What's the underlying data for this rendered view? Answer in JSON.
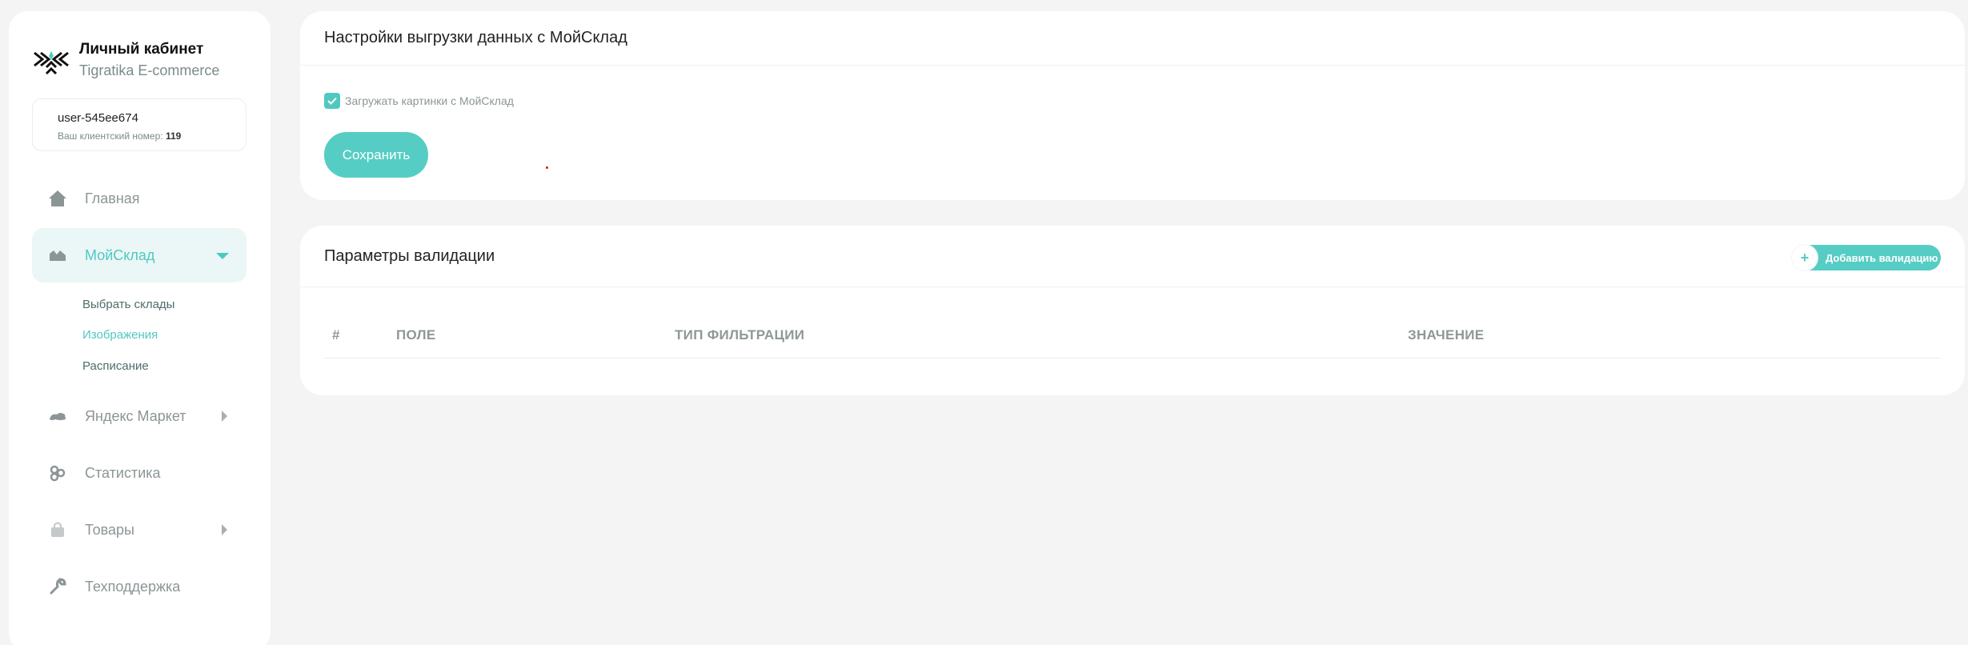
{
  "brand": {
    "title": "Личный кабинет",
    "subtitle": "Tigratika E-commerce"
  },
  "user": {
    "name": "user-545ee674",
    "client_label": "Ваш клиентский номер:",
    "client_number": "119"
  },
  "nav": {
    "home": "Главная",
    "moysklad": "МойСклад",
    "moysklad_sub": [
      "Выбрать склады",
      "Изображения",
      "Расписание"
    ],
    "yandex": "Яндекс Маркет",
    "stats": "Статистика",
    "goods": "Товары",
    "support": "Техподдержка"
  },
  "export_settings": {
    "title": "Настройки выгрузки данных с МойСклад",
    "checkbox_label": "Загружать картинки с МойСклад",
    "checkbox_checked": true,
    "save_label": "Сохранить"
  },
  "validation": {
    "title": "Параметры валидации",
    "add_label": "Добавить валидацию",
    "add_icon": "+",
    "columns": [
      "#",
      "ПОЛЕ",
      "ТИП ФИЛЬТРАЦИИ",
      "ЗНАЧЕНИЕ"
    ]
  },
  "colors": {
    "accent": "#56cdc4",
    "active_bg": "#eaf7f6",
    "muted_text": "#8b9596"
  }
}
